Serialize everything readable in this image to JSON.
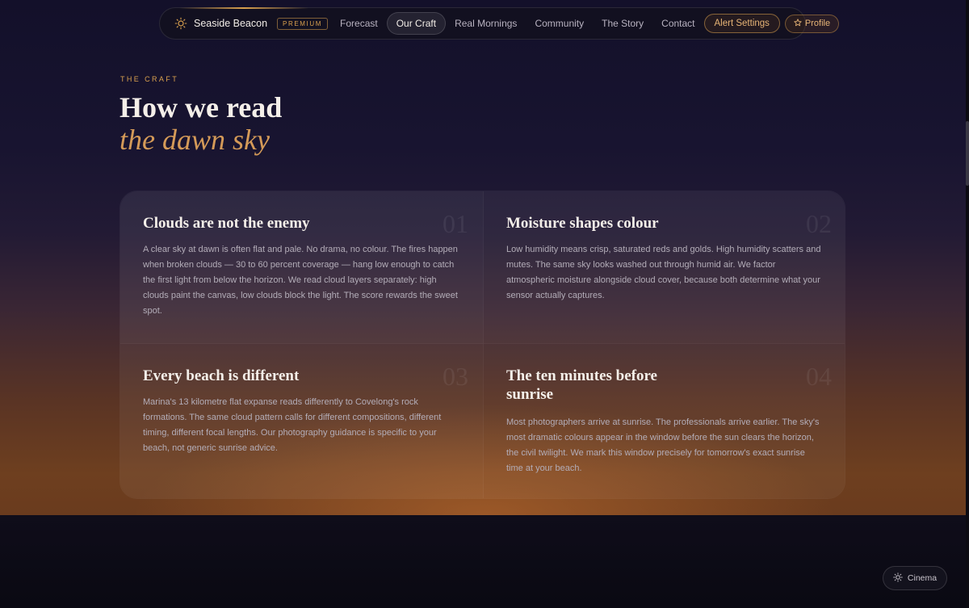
{
  "nav": {
    "brand": "Seaside Beacon",
    "badge": "PREMIUM",
    "links": [
      {
        "label": "Forecast",
        "active": false
      },
      {
        "label": "Our Craft",
        "active": true
      },
      {
        "label": "Real Mornings",
        "active": false
      },
      {
        "label": "Community",
        "active": false
      },
      {
        "label": "The Story",
        "active": false
      },
      {
        "label": "Contact",
        "active": false
      }
    ],
    "alert_button": "Alert Settings",
    "profile_button": "Profile",
    "icons": {
      "brand": "sun-icon",
      "profile": "star-icon"
    }
  },
  "section": {
    "eyebrow": "THE CRAFT",
    "title_line1": "How we read",
    "title_line2": "the dawn sky"
  },
  "cards": [
    {
      "title": "Clouds are not the enemy",
      "number": "01",
      "body": "A clear sky at dawn is often flat and pale. No drama, no colour. The fires happen when broken clouds — 30 to 60 percent coverage — hang low enough to catch the first light from below the horizon. We read cloud layers separately: high clouds paint the canvas, low clouds block the light. The score rewards the sweet spot."
    },
    {
      "title": "Moisture shapes colour",
      "number": "02",
      "body": "Low humidity means crisp, saturated reds and golds. High humidity scatters and mutes. The same sky looks washed out through humid air. We factor atmospheric moisture alongside cloud cover, because both determine what your sensor actually captures."
    },
    {
      "title": "Every beach is different",
      "number": "03",
      "body": "Marina's 13 kilometre flat expanse reads differently to Covelong's rock formations. The same cloud pattern calls for different compositions, different timing, different focal lengths. Our photography guidance is specific to your beach, not generic sunrise advice."
    },
    {
      "title": "The ten minutes before sunrise",
      "number": "04",
      "body": "Most photographers arrive at sunrise. The professionals arrive earlier. The sky's most dramatic colours appear in the window before the sun clears the horizon, the civil twilight. We mark this window precisely for tomorrow's exact sunrise time at your beach."
    }
  ],
  "cinema": {
    "label": "Cinema",
    "icon": "sun-icon"
  },
  "colors": {
    "accent": "#d9a04e",
    "title_italic": "#d49a58"
  }
}
